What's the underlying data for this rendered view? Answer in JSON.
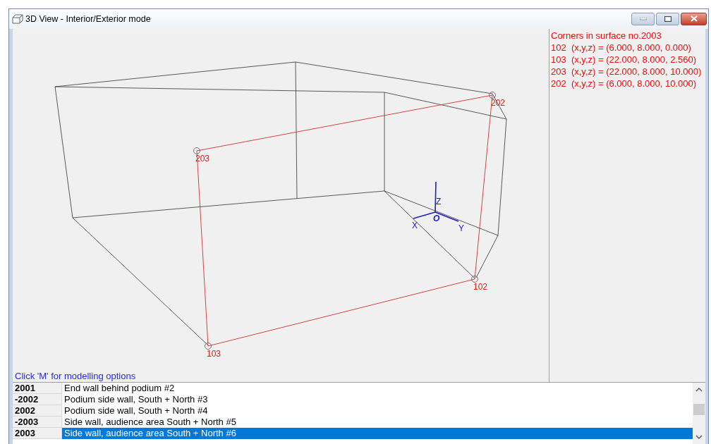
{
  "window": {
    "title": "3D View - Interior/Exterior mode"
  },
  "view": {
    "points": [
      {
        "label": "202"
      },
      {
        "label": "203"
      },
      {
        "label": "102"
      },
      {
        "label": "103"
      }
    ],
    "axes": {
      "x": "X",
      "y": "Y",
      "z": "Z",
      "origin": "O"
    },
    "hint": "Click 'M' for modelling options"
  },
  "info_panel": {
    "lines": [
      "Corners in surface no.2003",
      "102  (x,y,z) = (6.000, 8.000, 0.000)",
      "103  (x,y,z) = (22.000, 8.000, 2.560)",
      "203  (x,y,z) = (22.000, 8.000, 10.000)",
      "202  (x,y,z) = (6.000, 8.000, 10.000)"
    ]
  },
  "surfaces": [
    {
      "number": "2001",
      "name": "End wall behind podium #2",
      "selected": false
    },
    {
      "number": "-2002",
      "name": "Podium side wall, South + North #3",
      "selected": false
    },
    {
      "number": "2002",
      "name": "Podium side wall, South + North #4",
      "selected": false
    },
    {
      "number": "-2003",
      "name": "Side wall, audience area South + North #5",
      "selected": false
    },
    {
      "number": "2003",
      "name": "Side wall, audience area South + North #6",
      "selected": true
    }
  ]
}
